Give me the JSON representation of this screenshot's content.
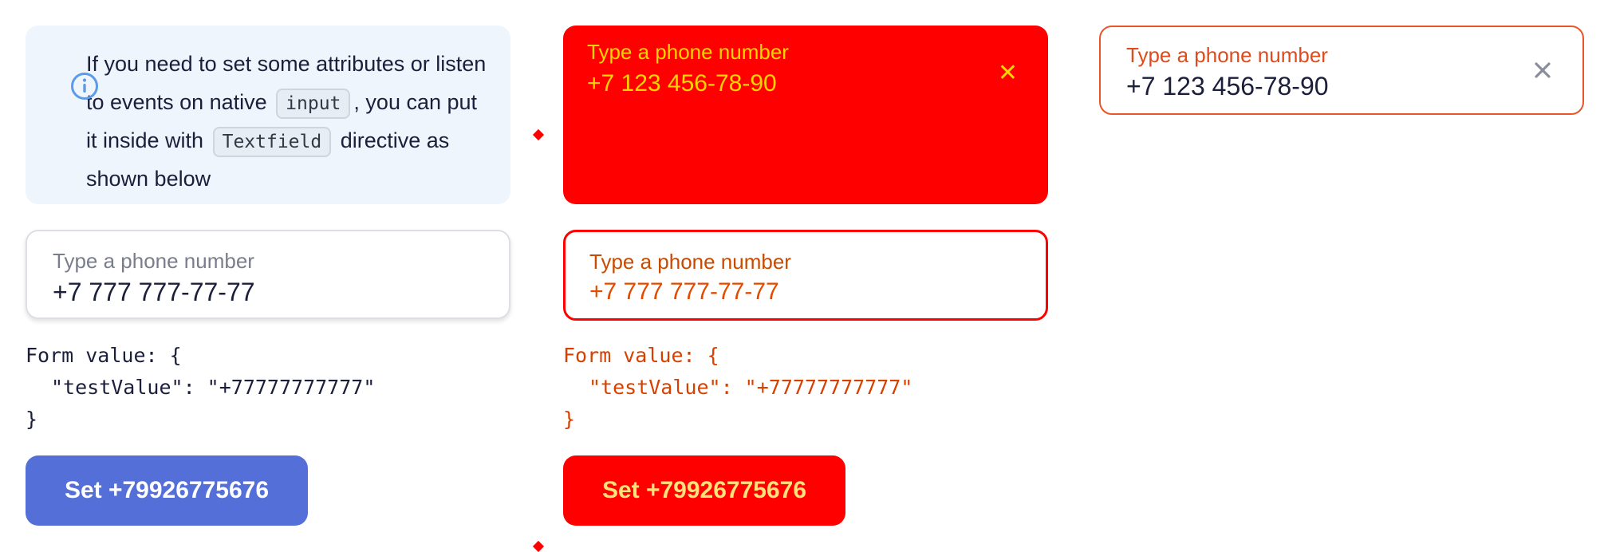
{
  "colors": {
    "primary": "#5470d8",
    "notice_bg": "#eef5fc",
    "error": "#e04b1c",
    "diff_red": "#ff0000"
  },
  "notice": {
    "text_before_input": "If you need to set some attributes or listen to events on native",
    "code_input": "input",
    "text_middle": ", you can put it inside with",
    "code_textfield": "Textfield",
    "text_after": "directive as shown below",
    "icon": "info-icon"
  },
  "textfield": {
    "label": "Type a phone number",
    "value": "+7 777 777-77-77"
  },
  "form_value": {
    "open": "Form value: {",
    "entry": "\"testValue\": \"+77777777777\"",
    "close": "}"
  },
  "set_button": {
    "label": "Set +79926775676"
  },
  "textfield_error": {
    "label": "Type a phone number",
    "value": "+7 123 456-78-90",
    "clear_icon": "close-icon"
  }
}
